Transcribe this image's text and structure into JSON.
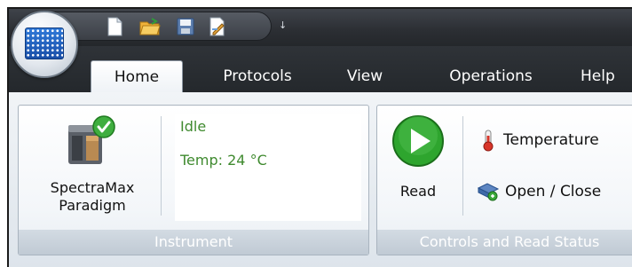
{
  "app": {
    "orb_icon": "microplate-icon"
  },
  "quick_access": {
    "buttons": [
      {
        "name": "new-file-icon"
      },
      {
        "name": "open-folder-icon"
      },
      {
        "name": "save-icon"
      },
      {
        "name": "edit-document-icon"
      }
    ],
    "dropdown_glyph": "↓"
  },
  "tabs": [
    {
      "label": "Home",
      "active": true
    },
    {
      "label": "Protocols",
      "active": false
    },
    {
      "label": "View",
      "active": false
    },
    {
      "label": "Operations",
      "active": false
    },
    {
      "label": "Help",
      "active": false
    }
  ],
  "instrument_group": {
    "label": "Instrument",
    "device_line1": "SpectraMax",
    "device_line2": "Paradigm",
    "status_text": "Idle",
    "temp_text": "Temp: 24 °C"
  },
  "controls_group": {
    "label": "Controls and Read Status",
    "read_label": "Read",
    "temperature_label": "Temperature",
    "open_close_label": "Open / Close"
  },
  "colors": {
    "status_green": "#3f8a2f",
    "read_green": "#2ea52e"
  }
}
